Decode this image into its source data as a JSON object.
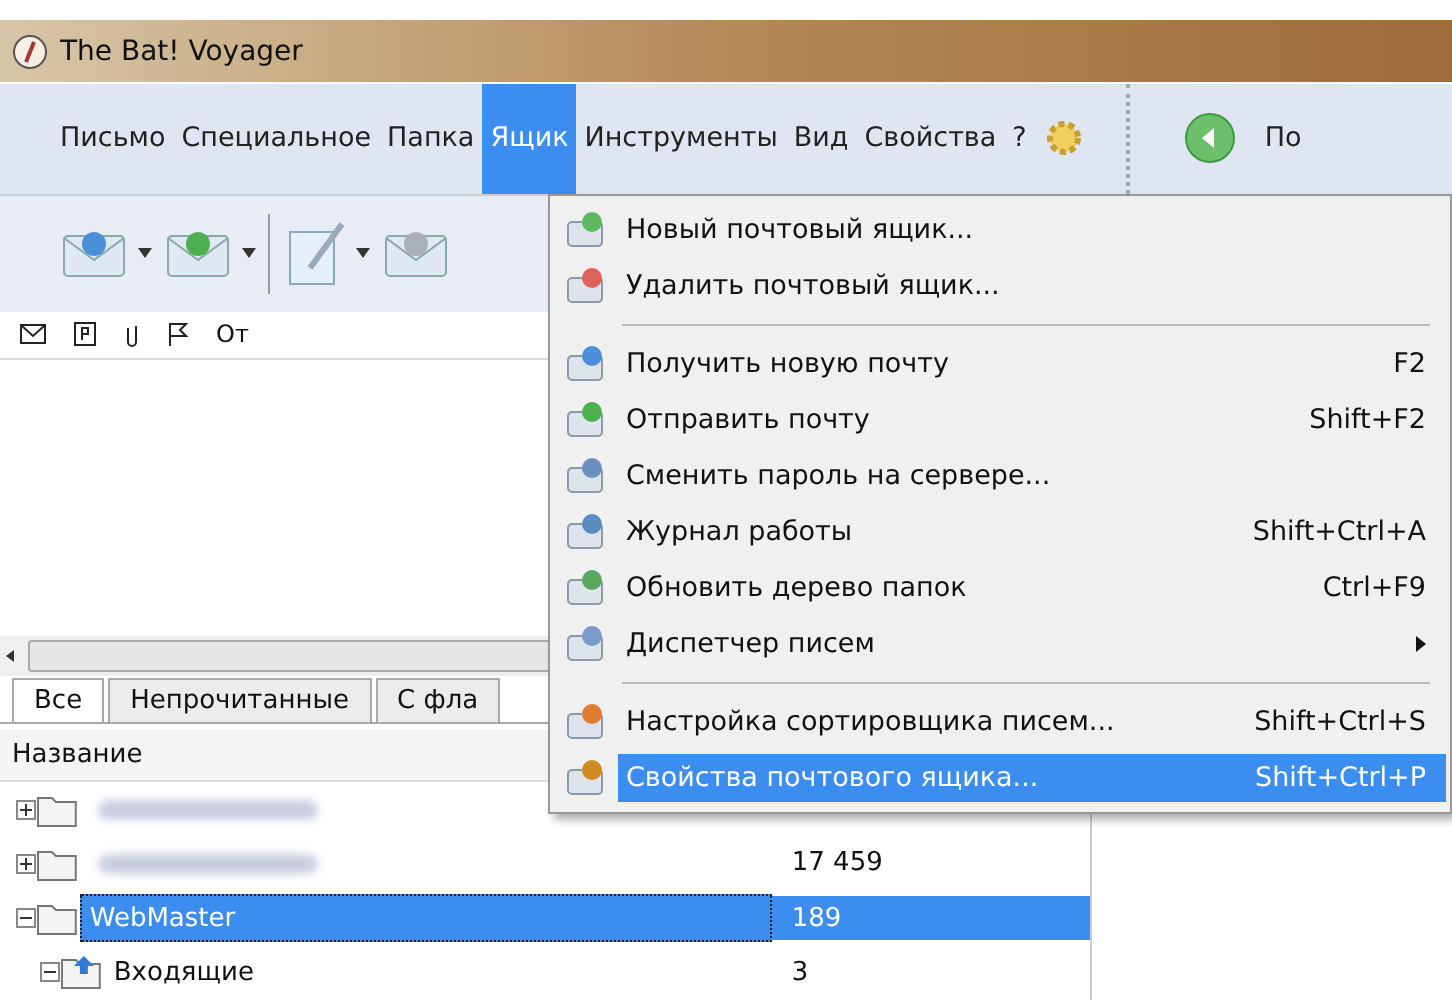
{
  "window": {
    "title": "The Bat! Voyager"
  },
  "menubar": [
    {
      "label": "Письмо",
      "selected": false
    },
    {
      "label": "Специальное",
      "selected": false
    },
    {
      "label": "Папка",
      "selected": false
    },
    {
      "label": "Ящик",
      "selected": true
    },
    {
      "label": "Инструменты",
      "selected": false
    },
    {
      "label": "Вид",
      "selected": false
    },
    {
      "label": "Свойства",
      "selected": false
    },
    {
      "label": "?",
      "selected": false
    }
  ],
  "nav_label": "По",
  "message_columns": [
    "От"
  ],
  "folder_tabs": [
    {
      "label": "Все",
      "selected": true
    },
    {
      "label": "Непрочитанные",
      "selected": false
    },
    {
      "label": "С фла",
      "selected": false
    }
  ],
  "folder_header": "Название",
  "folders": [
    {
      "kind": "blurred",
      "expanded": false,
      "selected": false
    },
    {
      "kind": "blurred",
      "count": "17 459",
      "expanded": false,
      "selected": false
    },
    {
      "kind": "account",
      "name": "WebMaster",
      "count": "189",
      "expanded": true,
      "selected": true
    },
    {
      "kind": "inbox",
      "name": "Входящие",
      "count": "3",
      "expanded": true,
      "selected": false
    }
  ],
  "dropdown": [
    {
      "kind": "item",
      "label": "Новый почтовый ящик...",
      "selected": false
    },
    {
      "kind": "item",
      "label": "Удалить почтовый ящик...",
      "selected": false
    },
    {
      "kind": "separator"
    },
    {
      "kind": "item",
      "label": "Получить новую почту",
      "shortcut": "F2",
      "selected": false
    },
    {
      "kind": "item",
      "label": "Отправить почту",
      "shortcut": "Shift+F2",
      "selected": false
    },
    {
      "kind": "item",
      "label": "Сменить пароль на сервере...",
      "selected": false
    },
    {
      "kind": "item",
      "label": "Журнал работы",
      "shortcut": "Shift+Ctrl+A",
      "selected": false
    },
    {
      "kind": "item",
      "label": "Обновить дерево папок",
      "shortcut": "Ctrl+F9",
      "selected": false
    },
    {
      "kind": "submenu",
      "label": "Диспетчер писем",
      "selected": false
    },
    {
      "kind": "separator"
    },
    {
      "kind": "item",
      "label": "Настройка сортировщика писем...",
      "shortcut": "Shift+Ctrl+S",
      "selected": false
    },
    {
      "kind": "item",
      "label": "Свойства почтового ящика...",
      "shortcut": "Shift+Ctrl+P",
      "selected": true
    }
  ]
}
